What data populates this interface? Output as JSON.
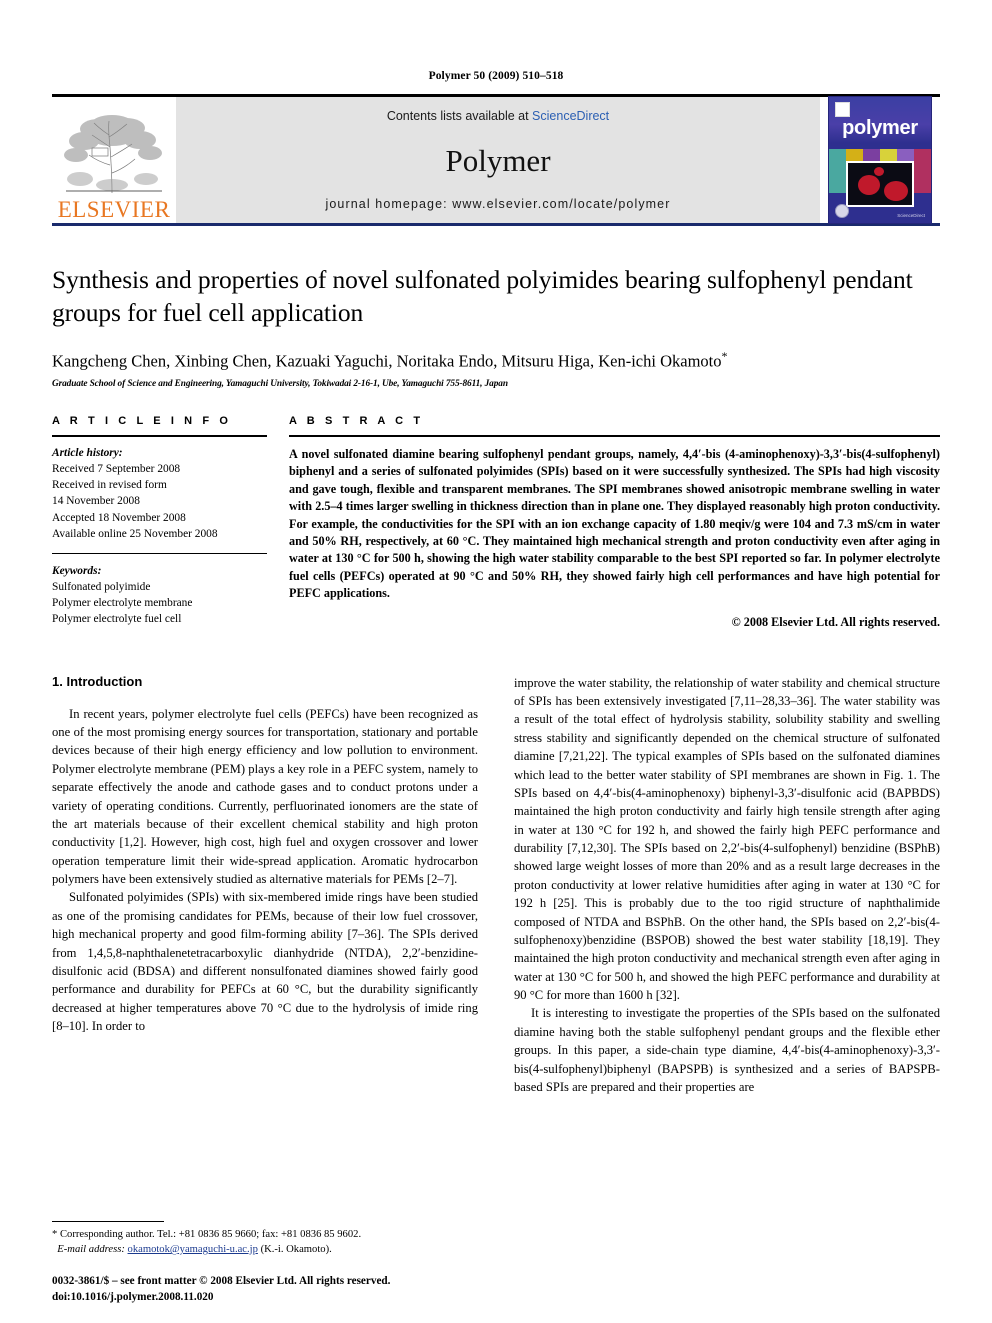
{
  "running_head": "Polymer 50 (2009) 510–518",
  "banner": {
    "publisher_logo_text": "ELSEVIER",
    "contents_prefix": "Contents lists available at ",
    "contents_link": "ScienceDirect",
    "journal_name": "Polymer",
    "homepage": "journal homepage: www.elsevier.com/locate/polymer",
    "cover_title": "polymer",
    "link_color": "#2b5fb3",
    "logo_color": "#E87722",
    "cover_bg": "#2e2f8f"
  },
  "article": {
    "title": "Synthesis and properties of novel sulfonated polyimides bearing sulfophenyl pendant groups for fuel cell application",
    "authors": "Kangcheng Chen, Xinbing Chen, Kazuaki Yaguchi, Noritaka Endo, Mitsuru Higa, Ken-ichi Okamoto",
    "corresponding_marker": "*",
    "affiliation": "Graduate School of Science and Engineering, Yamaguchi University, Tokiwadai 2-16-1, Ube, Yamaguchi 755-8611, Japan"
  },
  "article_info": {
    "heading": "A R T I C L E   I N F O",
    "history_label": "Article history:",
    "history": [
      "Received 7 September 2008",
      "Received in revised form",
      "14 November 2008",
      "Accepted 18 November 2008",
      "Available online 25 November 2008"
    ],
    "keywords_label": "Keywords:",
    "keywords": [
      "Sulfonated polyimide",
      "Polymer electrolyte membrane",
      "Polymer electrolyte fuel cell"
    ]
  },
  "abstract": {
    "heading": "A B S T R A C T",
    "text": "A novel sulfonated diamine bearing sulfophenyl pendant groups, namely, 4,4′-bis (4-aminophenoxy)-3,3′-bis(4-sulfophenyl) biphenyl and a series of sulfonated polyimides (SPIs) based on it were successfully synthesized. The SPIs had high viscosity and gave tough, flexible and transparent membranes. The SPI membranes showed anisotropic membrane swelling in water with 2.5–4 times larger swelling in thickness direction than in plane one. They displayed reasonably high proton conductivity. For example, the conductivities for the SPI with an ion exchange capacity of 1.80 meqiv/g were 104 and 7.3 mS/cm in water and 50% RH, respectively, at 60 °C. They maintained high mechanical strength and proton conductivity even after aging in water at 130 °C for 500 h, showing the high water stability comparable to the best SPI reported so far. In polymer electrolyte fuel cells (PEFCs) operated at 90 °C and 50% RH, they showed fairly high cell performances and have high potential for PEFC applications.",
    "copyright": "© 2008 Elsevier Ltd. All rights reserved."
  },
  "intro": {
    "heading": "1. Introduction",
    "left_paragraphs": [
      "In recent years, polymer electrolyte fuel cells (PEFCs) have been recognized as one of the most promising energy sources for transportation, stationary and portable devices because of their high energy efficiency and low pollution to environment. Polymer electrolyte membrane (PEM) plays a key role in a PEFC system, namely to separate effectively the anode and cathode gases and to conduct protons under a variety of operating conditions. Currently, perfluorinated ionomers are the state of the art materials because of their excellent chemical stability and high proton conductivity [1,2]. However, high cost, high fuel and oxygen crossover and lower operation temperature limit their wide-spread application. Aromatic hydrocarbon polymers have been extensively studied as alternative materials for PEMs [2–7].",
      "Sulfonated polyimides (SPIs) with six-membered imide rings have been studied as one of the promising candidates for PEMs, because of their low fuel crossover, high mechanical property and good film-forming ability [7–36]. The SPIs derived from 1,4,5,8-naphthalenetetracarboxylic dianhydride (NTDA), 2,2′-benzidine-disulfonic acid (BDSA) and different nonsulfonated diamines showed fairly good performance and durability for PEFCs at 60 °C, but the durability significantly decreased at higher temperatures above 70 °C due to the hydrolysis of imide ring [8–10]. In order to"
    ],
    "right_paragraphs": [
      "improve the water stability, the relationship of water stability and chemical structure of SPIs has been extensively investigated [7,11–28,33–36]. The water stability was a result of the total effect of hydrolysis stability, solubility stability and swelling stress stability and significantly depended on the chemical structure of sulfonated diamine [7,21,22]. The typical examples of SPIs based on the sulfonated diamines which lead to the better water stability of SPI membranes are shown in Fig. 1. The SPIs based on 4,4′-bis(4-aminophenoxy) biphenyl-3,3′-disulfonic acid (BAPBDS) maintained the high proton conductivity and fairly high tensile strength after aging in water at 130 °C for 192 h, and showed the fairly high PEFC performance and durability [7,12,30]. The SPIs based on 2,2′-bis(4-sulfophenyl) benzidine (BSPhB) showed large weight losses of more than 20% and as a result large decreases in the proton conductivity at lower relative humidities after aging in water at 130 °C for 192 h [25]. This is probably due to the too rigid structure of naphthalimide composed of NTDA and BSPhB. On the other hand, the SPIs based on 2,2′-bis(4-sulfophenoxy)benzidine (BSPOB) showed the best water stability [18,19]. They maintained the high proton conductivity and mechanical strength even after aging in water at 130 °C for 500 h, and showed the high PEFC performance and durability at 90 °C for more than 1600 h [32].",
      "It is interesting to investigate the properties of the SPIs based on the sulfonated diamine having both the stable sulfophenyl pendant groups and the flexible ether groups. In this paper, a side-chain type diamine, 4,4′-bis(4-aminophenoxy)-3,3′-bis(4-sulfophenyl)biphenyl (BAPSPB) is synthesized and a series of BAPSPB-based SPIs are prepared and their properties are"
    ]
  },
  "footer": {
    "corresponding_marker": "*",
    "corresponding_text": "Corresponding author. Tel.: +81 0836 85 9660; fax: +81 0836 85 9602.",
    "email_label": "E-mail address:",
    "email": "okamotok@yamaguchi-u.ac.jp",
    "email_suffix": "(K.-i. Okamoto).",
    "issn_line": "0032-3861/$ – see front matter © 2008 Elsevier Ltd. All rights reserved.",
    "doi_line": "doi:10.1016/j.polymer.2008.11.020"
  }
}
